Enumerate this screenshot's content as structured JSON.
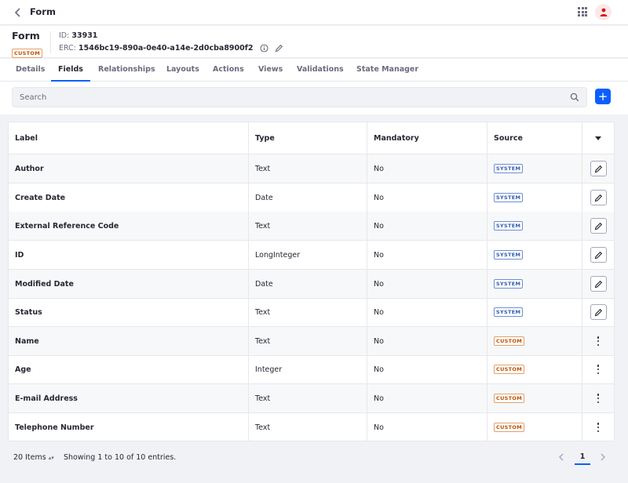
{
  "topbar": {
    "title": "Form",
    "back_icon": "chevron-left-icon",
    "apps_icon": "grid-icon",
    "avatar_icon": "user-icon",
    "avatar_color": "#da1414"
  },
  "header": {
    "object_name": "Form",
    "object_badge": "CUSTOM",
    "id_label": "ID:",
    "id_value": "33931",
    "erc_label": "ERC:",
    "erc_value": "1546bc19-890a-0e40-a14e-2d0cba8900f2",
    "erc_info_icon": "info-circle-icon",
    "erc_edit_icon": "pencil-icon"
  },
  "tabs": [
    {
      "label": "Details",
      "active": false
    },
    {
      "label": "Fields",
      "active": true
    },
    {
      "label": "Relationships",
      "active": false
    },
    {
      "label": "Layouts",
      "active": false
    },
    {
      "label": "Actions",
      "active": false
    },
    {
      "label": "Views",
      "active": false
    },
    {
      "label": "Validations",
      "active": false
    },
    {
      "label": "State Manager",
      "active": false
    }
  ],
  "search": {
    "placeholder": "Search",
    "value": ""
  },
  "add_button_label": "+",
  "table": {
    "columns": [
      "Label",
      "Type",
      "Mandatory",
      "Source"
    ],
    "rows": [
      {
        "label": "Author",
        "type": "Text",
        "mandatory": "No",
        "source": "SYSTEM",
        "action": "edit"
      },
      {
        "label": "Create Date",
        "type": "Date",
        "mandatory": "No",
        "source": "SYSTEM",
        "action": "edit"
      },
      {
        "label": "External Reference Code",
        "type": "Text",
        "mandatory": "No",
        "source": "SYSTEM",
        "action": "edit"
      },
      {
        "label": "ID",
        "type": "LongInteger",
        "mandatory": "No",
        "source": "SYSTEM",
        "action": "edit"
      },
      {
        "label": "Modified Date",
        "type": "Date",
        "mandatory": "No",
        "source": "SYSTEM",
        "action": "edit"
      },
      {
        "label": "Status",
        "type": "Text",
        "mandatory": "No",
        "source": "SYSTEM",
        "action": "edit"
      },
      {
        "label": "Name",
        "type": "Text",
        "mandatory": "No",
        "source": "CUSTOM",
        "action": "menu"
      },
      {
        "label": "Age",
        "type": "Integer",
        "mandatory": "No",
        "source": "CUSTOM",
        "action": "menu"
      },
      {
        "label": "E-mail Address",
        "type": "Text",
        "mandatory": "No",
        "source": "CUSTOM",
        "action": "menu"
      },
      {
        "label": "Telephone Number",
        "type": "Text",
        "mandatory": "No",
        "source": "CUSTOM",
        "action": "menu"
      }
    ]
  },
  "footer": {
    "items_per_page": "20 Items",
    "showing_text": "Showing 1 to 10 of 10 entries.",
    "current_page": "1"
  },
  "colors": {
    "accent": "#0b5fff",
    "system_badge": "#2e5aac",
    "custom_badge": "#b95000"
  }
}
